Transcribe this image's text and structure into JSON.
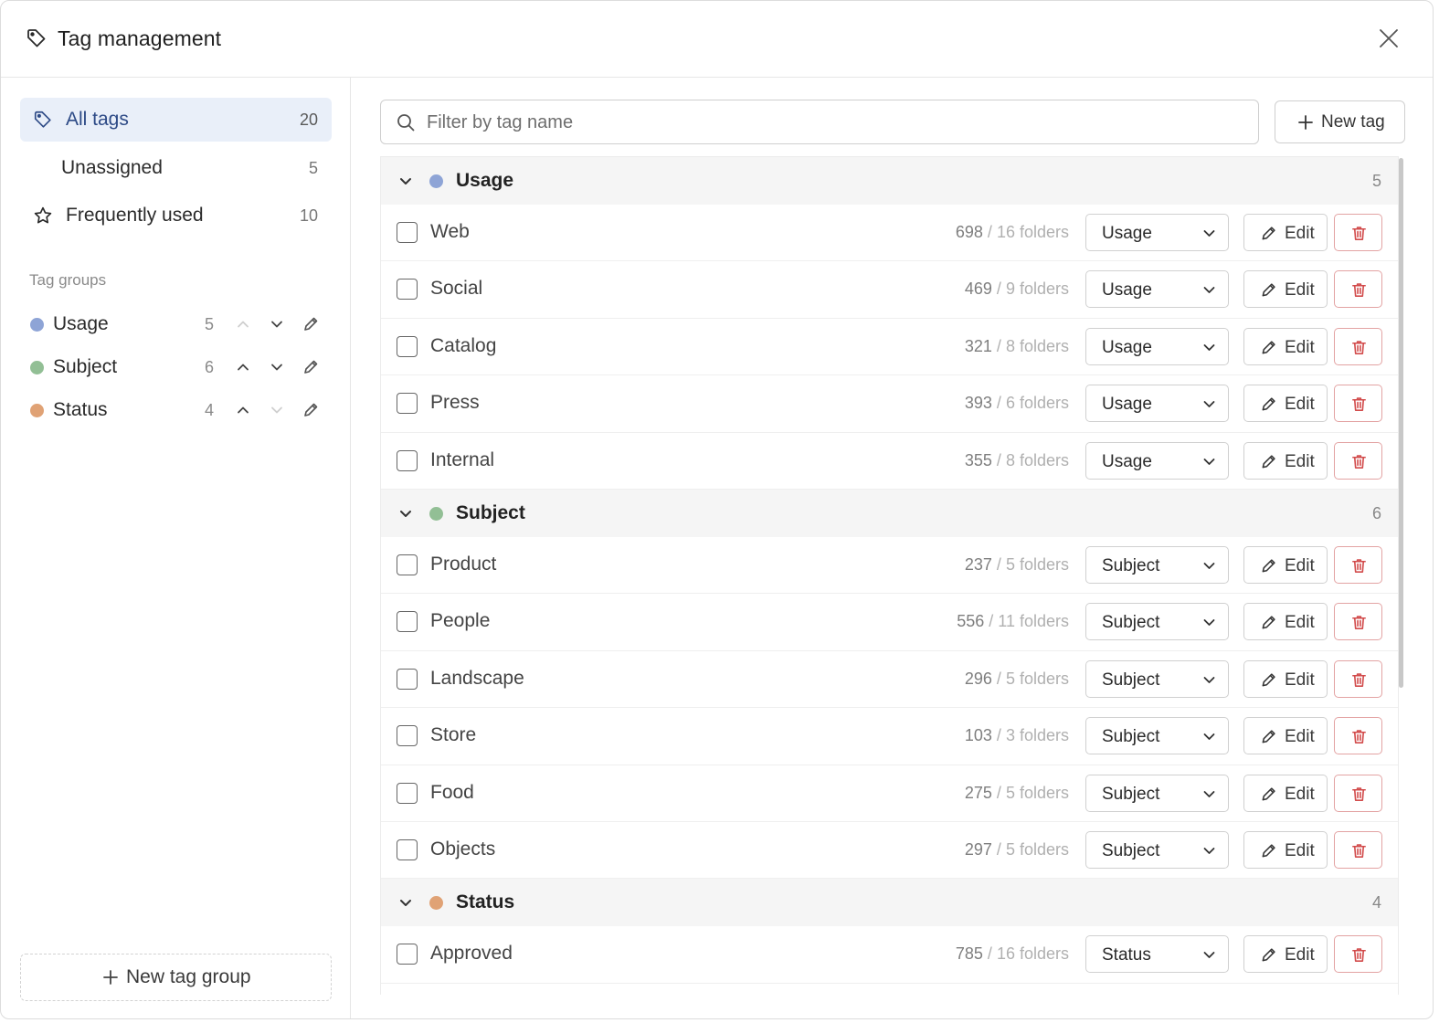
{
  "header": {
    "title": "Tag management"
  },
  "nav": {
    "all": {
      "label": "All tags",
      "count": "20"
    },
    "unassigned": {
      "label": "Unassigned",
      "count": "5"
    },
    "frequent": {
      "label": "Frequently used",
      "count": "10"
    }
  },
  "sidebar": {
    "groups_title": "Tag groups",
    "groups": [
      {
        "name": "Usage",
        "count": "5",
        "color": "#8ea4d6"
      },
      {
        "name": "Subject",
        "count": "6",
        "color": "#92bf95"
      },
      {
        "name": "Status",
        "count": "4",
        "color": "#e0a275"
      }
    ],
    "new_group_label": "New tag group"
  },
  "toolbar": {
    "search_placeholder": "Filter by tag name",
    "new_tag_label": "New tag"
  },
  "sections": [
    {
      "name": "Usage",
      "count": "5",
      "color": "#8ea4d6",
      "tags": [
        {
          "name": "Web",
          "files": "698",
          "folders": "16 folders",
          "group": "Usage"
        },
        {
          "name": "Social",
          "files": "469",
          "folders": "9 folders",
          "group": "Usage"
        },
        {
          "name": "Catalog",
          "files": "321",
          "folders": "8 folders",
          "group": "Usage"
        },
        {
          "name": "Press",
          "files": "393",
          "folders": "6 folders",
          "group": "Usage"
        },
        {
          "name": "Internal",
          "files": "355",
          "folders": "8 folders",
          "group": "Usage"
        }
      ]
    },
    {
      "name": "Subject",
      "count": "6",
      "color": "#92bf95",
      "tags": [
        {
          "name": "Product",
          "files": "237",
          "folders": "5 folders",
          "group": "Subject"
        },
        {
          "name": "People",
          "files": "556",
          "folders": "11 folders",
          "group": "Subject"
        },
        {
          "name": "Landscape",
          "files": "296",
          "folders": "5 folders",
          "group": "Subject"
        },
        {
          "name": "Store",
          "files": "103",
          "folders": "3 folders",
          "group": "Subject"
        },
        {
          "name": "Food",
          "files": "275",
          "folders": "5 folders",
          "group": "Subject"
        },
        {
          "name": "Objects",
          "files": "297",
          "folders": "5 folders",
          "group": "Subject"
        }
      ]
    },
    {
      "name": "Status",
      "count": "4",
      "color": "#e0a275",
      "tags": [
        {
          "name": "Approved",
          "files": "785",
          "folders": "16 folders",
          "group": "Status"
        }
      ]
    }
  ],
  "labels": {
    "edit": "Edit",
    "slash": "/"
  },
  "icons": {
    "header": "tag-icon",
    "close": "close-icon",
    "all": "tag-icon",
    "frequent": "star-icon",
    "move_up": "chevron-up-icon",
    "move_down": "chevron-down-icon",
    "rename": "pencil-icon",
    "search": "search-icon",
    "add": "plus-icon",
    "collapse": "chevron-down-icon",
    "dropdown": "chevron-down-icon",
    "edit": "pencil-icon",
    "delete": "trash-icon"
  },
  "colors": {
    "accent_bg": "#e9eff9",
    "accent_text": "#2d4a86",
    "danger": "#d24b4b"
  }
}
